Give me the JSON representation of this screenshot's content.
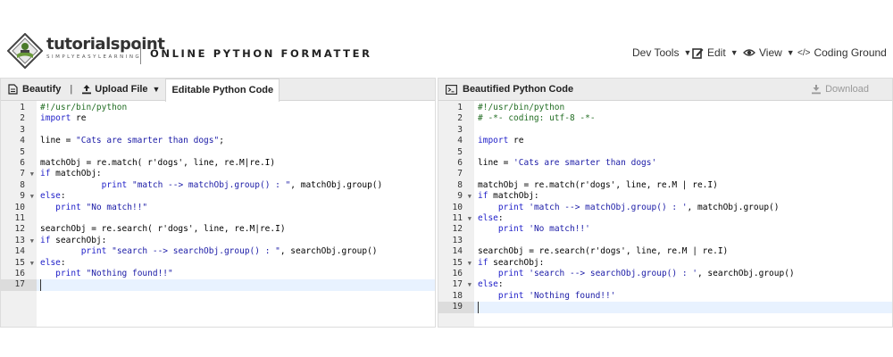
{
  "header": {
    "brand_name": "tutorialspoint",
    "brand_tagline": "SIMPLYEASYLEARNING",
    "app_title": "ONLINE PYTHON FORMATTER",
    "menu": {
      "dev_tools": "Dev Tools",
      "edit": "Edit",
      "view": "View",
      "coding_ground": "Coding Ground"
    }
  },
  "left_panel": {
    "beautify_label": "Beautify",
    "separator": "|",
    "upload_label": "Upload File",
    "tab_label": "Editable Python Code",
    "active_line": 17,
    "lines": [
      {
        "n": "1",
        "fold": false,
        "indent": "",
        "tokens": [
          {
            "t": "#!/usr/bin/python",
            "c": "comment"
          }
        ]
      },
      {
        "n": "2",
        "fold": false,
        "indent": "",
        "tokens": [
          {
            "t": "import",
            "c": "kw"
          },
          {
            "t": " re",
            "c": "plain"
          }
        ]
      },
      {
        "n": "3",
        "fold": false,
        "indent": "",
        "tokens": []
      },
      {
        "n": "4",
        "fold": false,
        "indent": "",
        "tokens": [
          {
            "t": "line = ",
            "c": "plain"
          },
          {
            "t": "\"Cats are smarter than dogs\"",
            "c": "str"
          },
          {
            "t": ";",
            "c": "plain"
          }
        ]
      },
      {
        "n": "5",
        "fold": false,
        "indent": "",
        "tokens": []
      },
      {
        "n": "6",
        "fold": false,
        "indent": "",
        "tokens": [
          {
            "t": "matchObj = re.match( r'dogs', line, re.M|re.I)",
            "c": "plain"
          }
        ]
      },
      {
        "n": "7",
        "fold": true,
        "indent": "",
        "tokens": [
          {
            "t": "if",
            "c": "kw"
          },
          {
            "t": " matchObj:",
            "c": "plain"
          }
        ]
      },
      {
        "n": "8",
        "fold": false,
        "indent": "            ",
        "tokens": [
          {
            "t": "print",
            "c": "kw"
          },
          {
            "t": " ",
            "c": "plain"
          },
          {
            "t": "\"match --> matchObj.group() : \"",
            "c": "str"
          },
          {
            "t": ", matchObj.group()",
            "c": "plain"
          }
        ]
      },
      {
        "n": "9",
        "fold": true,
        "indent": "",
        "tokens": [
          {
            "t": "else",
            "c": "kw"
          },
          {
            "t": ":",
            "c": "plain"
          }
        ]
      },
      {
        "n": "10",
        "fold": false,
        "indent": "   ",
        "tokens": [
          {
            "t": "print",
            "c": "kw"
          },
          {
            "t": " ",
            "c": "plain"
          },
          {
            "t": "\"No match!!\"",
            "c": "str"
          }
        ]
      },
      {
        "n": "11",
        "fold": false,
        "indent": "",
        "tokens": []
      },
      {
        "n": "12",
        "fold": false,
        "indent": "",
        "tokens": [
          {
            "t": "searchObj = re.search( r'dogs', line, re.M|re.I)",
            "c": "plain"
          }
        ]
      },
      {
        "n": "13",
        "fold": true,
        "indent": "",
        "tokens": [
          {
            "t": "if",
            "c": "kw"
          },
          {
            "t": " searchObj:",
            "c": "plain"
          }
        ]
      },
      {
        "n": "14",
        "fold": false,
        "indent": "        ",
        "tokens": [
          {
            "t": "print",
            "c": "kw"
          },
          {
            "t": " ",
            "c": "plain"
          },
          {
            "t": "\"search --> searchObj.group() : \"",
            "c": "str"
          },
          {
            "t": ", searchObj.group()",
            "c": "plain"
          }
        ]
      },
      {
        "n": "15",
        "fold": true,
        "indent": "",
        "tokens": [
          {
            "t": "else",
            "c": "kw"
          },
          {
            "t": ":",
            "c": "plain"
          }
        ]
      },
      {
        "n": "16",
        "fold": false,
        "indent": "   ",
        "tokens": [
          {
            "t": "print",
            "c": "kw"
          },
          {
            "t": " ",
            "c": "plain"
          },
          {
            "t": "\"Nothing found!!\"",
            "c": "str"
          }
        ]
      },
      {
        "n": "17",
        "fold": false,
        "indent": "",
        "tokens": []
      }
    ]
  },
  "right_panel": {
    "title": "Beautified Python Code",
    "download_label": "Download",
    "active_line": 19,
    "lines": [
      {
        "n": "1",
        "fold": false,
        "indent": "",
        "tokens": [
          {
            "t": "#!/usr/bin/python",
            "c": "comment"
          }
        ]
      },
      {
        "n": "2",
        "fold": false,
        "indent": "",
        "tokens": [
          {
            "t": "# -*- coding: utf-8 -*-",
            "c": "comment"
          }
        ]
      },
      {
        "n": "3",
        "fold": false,
        "indent": "",
        "tokens": []
      },
      {
        "n": "4",
        "fold": false,
        "indent": "",
        "tokens": [
          {
            "t": "import",
            "c": "kw"
          },
          {
            "t": " re",
            "c": "plain"
          }
        ]
      },
      {
        "n": "5",
        "fold": false,
        "indent": "",
        "tokens": []
      },
      {
        "n": "6",
        "fold": false,
        "indent": "",
        "tokens": [
          {
            "t": "line = ",
            "c": "plain"
          },
          {
            "t": "'Cats are smarter than dogs'",
            "c": "str"
          }
        ]
      },
      {
        "n": "7",
        "fold": false,
        "indent": "",
        "tokens": []
      },
      {
        "n": "8",
        "fold": false,
        "indent": "",
        "tokens": [
          {
            "t": "matchObj = re.match(r'dogs', line, re.M | re.I)",
            "c": "plain"
          }
        ]
      },
      {
        "n": "9",
        "fold": true,
        "indent": "",
        "tokens": [
          {
            "t": "if",
            "c": "kw"
          },
          {
            "t": " matchObj:",
            "c": "plain"
          }
        ]
      },
      {
        "n": "10",
        "fold": false,
        "indent": "    ",
        "tokens": [
          {
            "t": "print",
            "c": "kw"
          },
          {
            "t": " ",
            "c": "plain"
          },
          {
            "t": "'match --> matchObj.group() : '",
            "c": "str"
          },
          {
            "t": ", matchObj.group()",
            "c": "plain"
          }
        ]
      },
      {
        "n": "11",
        "fold": true,
        "indent": "",
        "tokens": [
          {
            "t": "else",
            "c": "kw"
          },
          {
            "t": ":",
            "c": "plain"
          }
        ]
      },
      {
        "n": "12",
        "fold": false,
        "indent": "    ",
        "tokens": [
          {
            "t": "print",
            "c": "kw"
          },
          {
            "t": " ",
            "c": "plain"
          },
          {
            "t": "'No match!!'",
            "c": "str"
          }
        ]
      },
      {
        "n": "13",
        "fold": false,
        "indent": "",
        "tokens": []
      },
      {
        "n": "14",
        "fold": false,
        "indent": "",
        "tokens": [
          {
            "t": "searchObj = re.search(r'dogs', line, re.M | re.I)",
            "c": "plain"
          }
        ]
      },
      {
        "n": "15",
        "fold": true,
        "indent": "",
        "tokens": [
          {
            "t": "if",
            "c": "kw"
          },
          {
            "t": " searchObj:",
            "c": "plain"
          }
        ]
      },
      {
        "n": "16",
        "fold": false,
        "indent": "    ",
        "tokens": [
          {
            "t": "print",
            "c": "kw"
          },
          {
            "t": " ",
            "c": "plain"
          },
          {
            "t": "'search --> searchObj.group() : '",
            "c": "str"
          },
          {
            "t": ", searchObj.group()",
            "c": "plain"
          }
        ]
      },
      {
        "n": "17",
        "fold": true,
        "indent": "",
        "tokens": [
          {
            "t": "else",
            "c": "kw"
          },
          {
            "t": ":",
            "c": "plain"
          }
        ]
      },
      {
        "n": "18",
        "fold": false,
        "indent": "    ",
        "tokens": [
          {
            "t": "print",
            "c": "kw"
          },
          {
            "t": " ",
            "c": "plain"
          },
          {
            "t": "'Nothing found!!'",
            "c": "str"
          }
        ]
      },
      {
        "n": "19",
        "fold": false,
        "indent": "",
        "tokens": []
      }
    ]
  },
  "icons": {
    "logo": "tutorialspoint-logo",
    "beautify": "document-icon",
    "upload": "upload-icon",
    "dropdown": "caret-down-icon",
    "edit": "edit-icon",
    "view": "eye-icon",
    "coding_ground": "code-icon",
    "terminal": "terminal-icon",
    "download": "download-icon",
    "fold": "fold-arrow-icon"
  },
  "colors": {
    "toolbar_bg": "#ececec",
    "gutter_bg": "#f0f0f0",
    "active_line_bg": "#e8f2ff",
    "comment": "#236e24",
    "keyword": "#1e1ec8",
    "string": "#1a1aa6"
  }
}
